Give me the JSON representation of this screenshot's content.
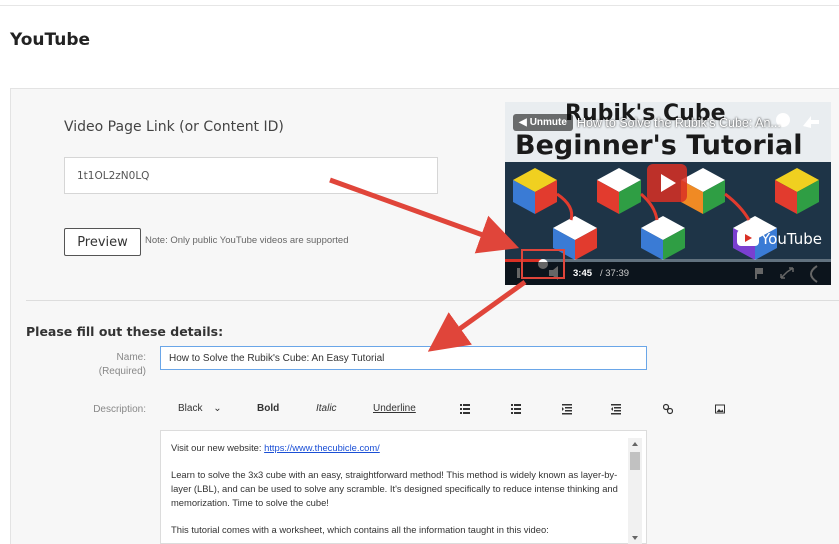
{
  "page": {
    "title": "YouTube"
  },
  "video_link": {
    "label": "Video Page Link (or Content ID)",
    "value": "1t1OL2zN0LQ"
  },
  "preview": {
    "button_label": "Preview",
    "note": "Note: Only public YouTube videos are supported"
  },
  "video_player": {
    "unmute_label": "Unmute",
    "title": "How to Solve the Rubik's Cube: An...",
    "thumbnail_text_line1": "Rubik's Cube",
    "thumbnail_text_line2": "Beginner's Tutorial",
    "current_time": "3:45",
    "total_time": "/ 37:39",
    "brand": "YouTube"
  },
  "details": {
    "heading": "Please fill out these details:",
    "name_label": "Name:",
    "name_required": "(Required)",
    "name_value": "How to Solve the Rubik's Cube: An Easy Tutorial",
    "description_label": "Description:"
  },
  "toolbar": {
    "color": "Black",
    "bold": "Bold",
    "italic": "Italic",
    "underline": "Underline",
    "icons": [
      "bullet-list-icon",
      "numbered-list-icon",
      "outdent-icon",
      "indent-icon",
      "link-icon",
      "image-icon"
    ]
  },
  "description": {
    "line1_prefix": "Visit our new website: ",
    "line1_link": "https://www.thecubicle.com/",
    "para2": "Learn to solve the 3x3 cube with an easy, straightforward method! This method is widely known as layer-by-layer (LBL), and can be used to solve any scramble. It's designed specifically to reduce intense thinking and memorization. Time to solve the cube!",
    "para3": "This tutorial comes with a worksheet, which contains all the information taught in this video:"
  },
  "colors": {
    "accent_red": "#e0453a",
    "focus_blue": "#6aa6e8",
    "link_blue": "#1a4fd6"
  }
}
